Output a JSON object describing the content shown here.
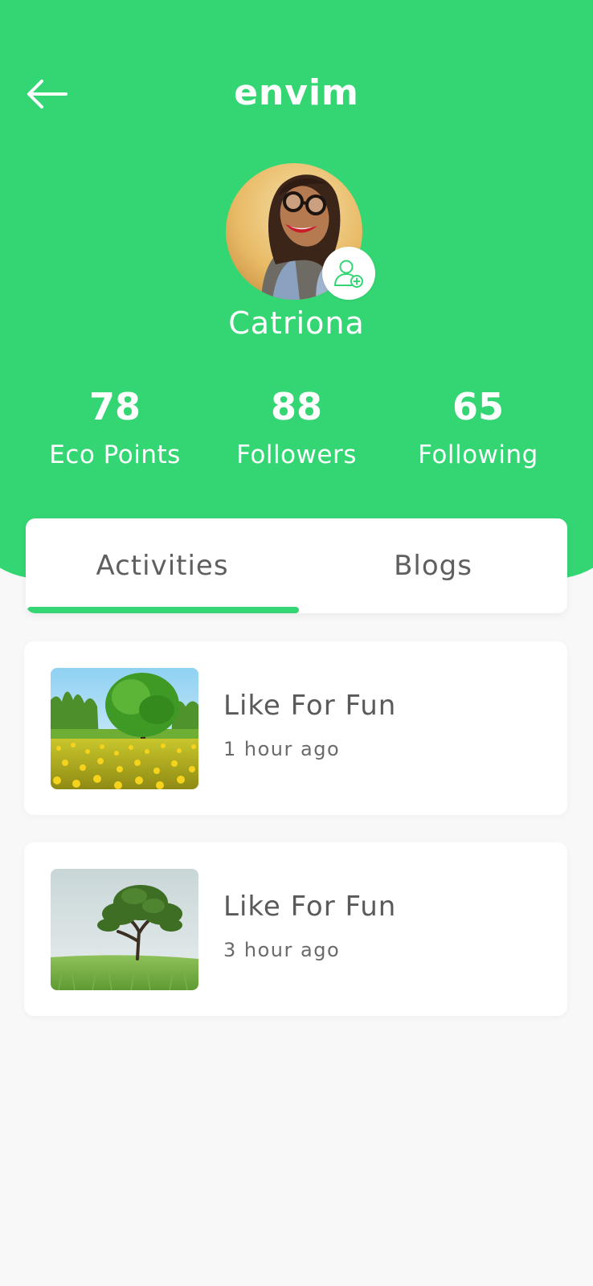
{
  "header": {
    "title": "envim",
    "back_icon": "arrow-left-icon",
    "color": "#34d673"
  },
  "profile": {
    "name": "Catriona",
    "add_friend_icon": "add-user-icon"
  },
  "stats": [
    {
      "value": "78",
      "label": "Eco Points"
    },
    {
      "value": "88",
      "label": "Followers"
    },
    {
      "value": "65",
      "label": "Following"
    }
  ],
  "tabs": [
    {
      "label": "Activities",
      "active": true
    },
    {
      "label": "Blogs",
      "active": false
    }
  ],
  "activities": [
    {
      "title": "Like For Fun",
      "time": "1 hour ago",
      "image": "meadow-tree-with-yellow-flowers"
    },
    {
      "title": "Like For Fun",
      "time": "3 hour ago",
      "image": "lone-tree-on-grass-field"
    }
  ]
}
